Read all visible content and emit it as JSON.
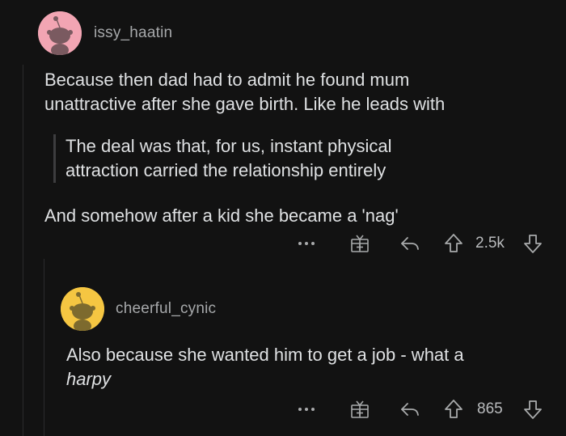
{
  "comments": [
    {
      "username": "issy_haatin",
      "avatar_color": "#f2a5b3",
      "body_line1": "Because then dad had to admit he found mum",
      "body_line2": "unattractive after she gave birth. Like he leads with",
      "quote_line1": "The deal was that, for us, instant physical",
      "quote_line2": "attraction carried the relationship entirely",
      "body_after": "And somehow after a kid she became a 'nag'",
      "vote_count": "2.5k"
    },
    {
      "username": "cheerful_cynic",
      "avatar_color": "#f5c642",
      "body_line1": "Also because she wanted him to get a job - what a",
      "body_line2_italic": "harpy",
      "vote_count": "865"
    }
  ],
  "icons": {
    "more": "more-options-icon",
    "award": "award-gift-icon",
    "reply": "reply-arrow-icon",
    "upvote": "upvote-arrow-icon",
    "downvote": "downvote-arrow-icon"
  },
  "colors": {
    "background": "#121212",
    "text": "#dfe1e3",
    "muted": "#a8aaab"
  }
}
